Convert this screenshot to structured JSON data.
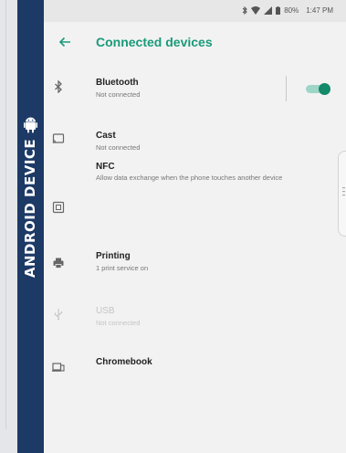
{
  "banner": {
    "label": "ANDROID DEVICE",
    "color": "#1d3a66"
  },
  "status_bar": {
    "battery": "80%",
    "time": "1:47 PM"
  },
  "app_bar": {
    "title": "Connected devices",
    "accent": "#1a9a7a"
  },
  "items": [
    {
      "icon": "bluetooth-icon",
      "title": "Bluetooth",
      "subtitle": "Not connected",
      "toggle_on": true
    },
    {
      "icon": "cast-icon",
      "title": "Cast",
      "subtitle": "Not connected"
    },
    {
      "icon": "nfc-icon",
      "title": "NFC",
      "subtitle": "Allow data exchange when the phone touches another device"
    },
    {
      "icon": "print-icon",
      "title": "Printing",
      "subtitle": "1 print service on"
    },
    {
      "icon": "usb-icon",
      "title": "USB",
      "subtitle": "Not connected",
      "disabled": true
    },
    {
      "icon": "chromebook-icon",
      "title": "Chromebook",
      "subtitle": ""
    }
  ]
}
